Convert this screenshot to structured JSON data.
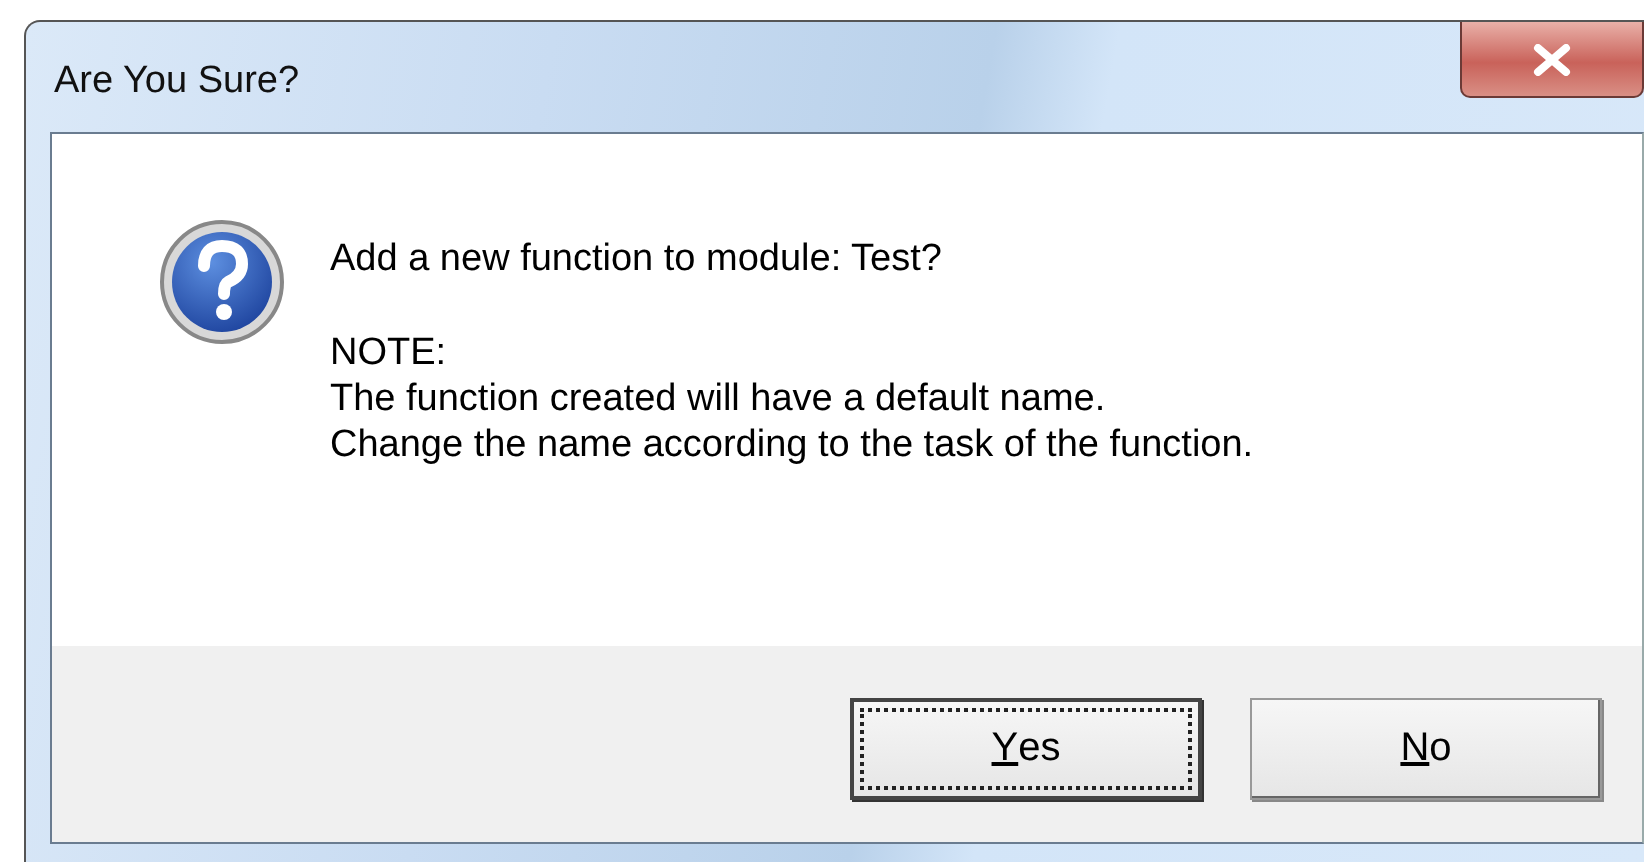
{
  "window": {
    "title": "Are You Sure?"
  },
  "message": {
    "question": "Add a new function to module: Test?",
    "lines": [
      "NOTE:",
      "The function created will have a default name.",
      "Change the name according to the task of the function."
    ]
  },
  "buttons": [
    {
      "label": "Yes",
      "focused": true,
      "mnemonic_underlined": true
    },
    {
      "label": "No",
      "focused": false,
      "mnemonic_underlined": true
    }
  ]
}
